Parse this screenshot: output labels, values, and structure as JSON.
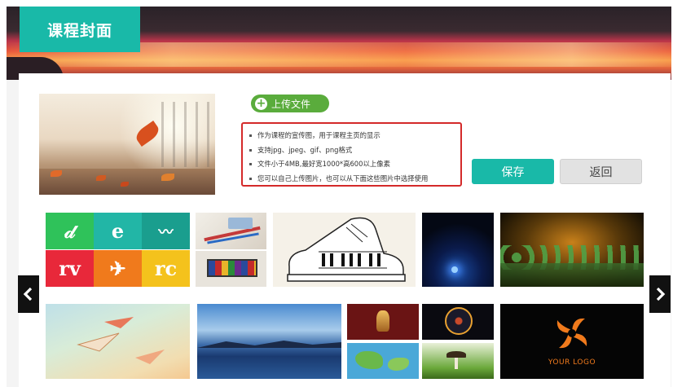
{
  "header": {
    "title": "课程封面"
  },
  "upload": {
    "label": "上传文件"
  },
  "notes": [
    "作为课程的宣传图，用于课程主页的显示",
    "支持jpg、jpeg、gif、png格式",
    "文件小于4MB,最好宽1000*高600以上像素",
    "您可以自己上传图片，也可以从下面这些图片中选择使用"
  ],
  "actions": {
    "save": "保存",
    "back": "返回"
  },
  "gallery": {
    "logo_text": "YOUR LOGO",
    "app_icons": [
      "𝒹",
      "e",
      "〰",
      "rv",
      "✈",
      "rc"
    ]
  },
  "colors": {
    "accent": "#19b9a8",
    "upload_green": "#5aac3c",
    "notes_border": "#d42a2a"
  }
}
